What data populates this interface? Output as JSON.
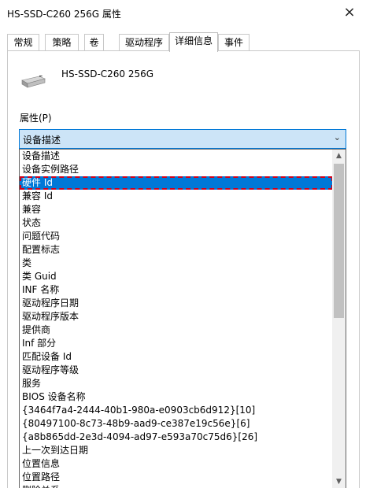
{
  "window": {
    "title": "HS-SSD-C260 256G 属性",
    "close_icon": "×"
  },
  "tabs": [
    {
      "label": "常规"
    },
    {
      "label": "策略"
    },
    {
      "label": "卷"
    },
    {
      "label": "驱动程序"
    },
    {
      "label": "详细信息",
      "active": true
    },
    {
      "label": "事件"
    }
  ],
  "device": {
    "name": "HS-SSD-C260 256G",
    "icon": "drive-icon"
  },
  "property": {
    "label": "属性(P)",
    "selected": "设备描述"
  },
  "dropdown": {
    "selected_index": 2,
    "items": [
      "设备描述",
      "设备实例路径",
      "硬件 Id",
      "兼容 Id",
      "兼容",
      "状态",
      "问题代码",
      "配置标志",
      "类",
      "类 Guid",
      "INF 名称",
      "驱动程序日期",
      "驱动程序版本",
      "提供商",
      "Inf 部分",
      "匹配设备 Id",
      "驱动程序等级",
      "服务",
      "BIOS 设备名称",
      "{3464f7a4-2444-40b1-980a-e0903cb6d912}[10]",
      "{80497100-8c73-48b9-aad9-ce387e19c56e}[6]",
      "{a8b865dd-2e3d-4094-ad97-e593a70c75d6}[26]",
      "上一次到达日期",
      "位置信息",
      "位置路径",
      "删除关系"
    ]
  }
}
